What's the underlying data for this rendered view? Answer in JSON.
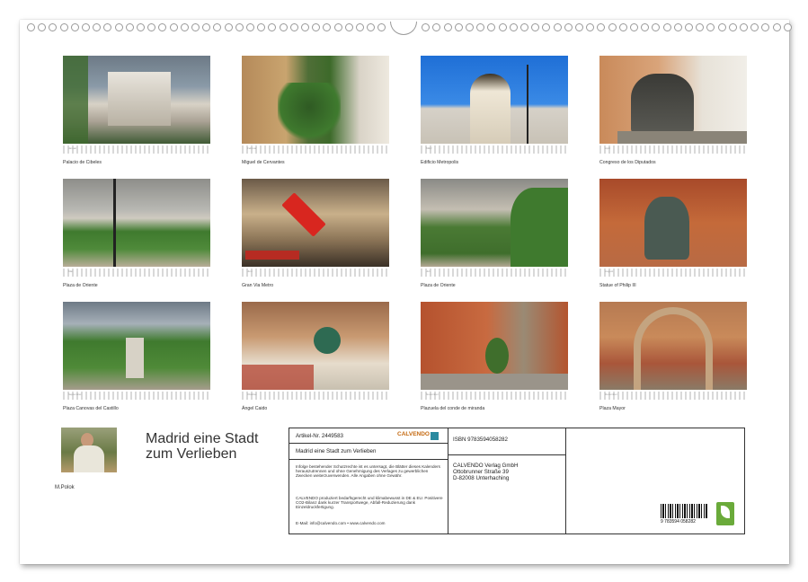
{
  "calendar": {
    "title_line1": "Madrid eine Stadt",
    "title_line2": "zum Verlieben",
    "author": "M.Polok",
    "photos": [
      {
        "caption": "Palacio de Cibeles"
      },
      {
        "caption": "Miguel de Cervantes"
      },
      {
        "caption": "Edificio Metropolis"
      },
      {
        "caption": "Congreso de los Diputados"
      },
      {
        "caption": "Plaza de Oriente"
      },
      {
        "caption": "Gran Via Metro"
      },
      {
        "caption": "Plaza de Oriente"
      },
      {
        "caption": "Statue of Philip III"
      },
      {
        "caption": "Plaza Canovas del Castillo"
      },
      {
        "caption": "Ángel Caido"
      },
      {
        "caption": "Plazuela del conde de miranda"
      },
      {
        "caption": "Plaza Mayor"
      }
    ],
    "months": [
      "Januar",
      "Februar",
      "März",
      "April",
      "Mai",
      "Juni",
      "Juli",
      "August",
      "September",
      "Oktober",
      "November",
      "Dezember"
    ]
  },
  "info": {
    "article": "Artikel-Nr. 2449583",
    "brand": "CALVENDO",
    "subject": "Madrid eine Stadt zum Verlieben",
    "legal1": "Infolge bestehender Schutzrechte ist es untersagt, die Blätter dieses Kalenders herauszutrennen und ohne Genehmigung des Verlages zu gewerblichen Zwecken weiterzuverwenden. Alle Angaben ohne Gewähr.",
    "legal2": "CALVENDO produziert bedarfsgerecht und klimabewusst in DE & EU. Positivere CO2-Bilanz dank kurzer Transportwege, Abfall-Reduzierung dank Einzeldruckfertigung.",
    "contact": "E-Mail: info@calvendo.com • www.calvendo.com",
    "isbn": "ISBN 9783594058282",
    "publisher1": "CALVENDO Verlag GmbH",
    "publisher2": "Ottobrunner Straße 39",
    "publisher3": "D-82008 Unterhaching",
    "barcode_number": "9 783594 058282"
  },
  "colors": {
    "brand_green": "#6aaa3a",
    "brand_text": "#c46a12"
  }
}
